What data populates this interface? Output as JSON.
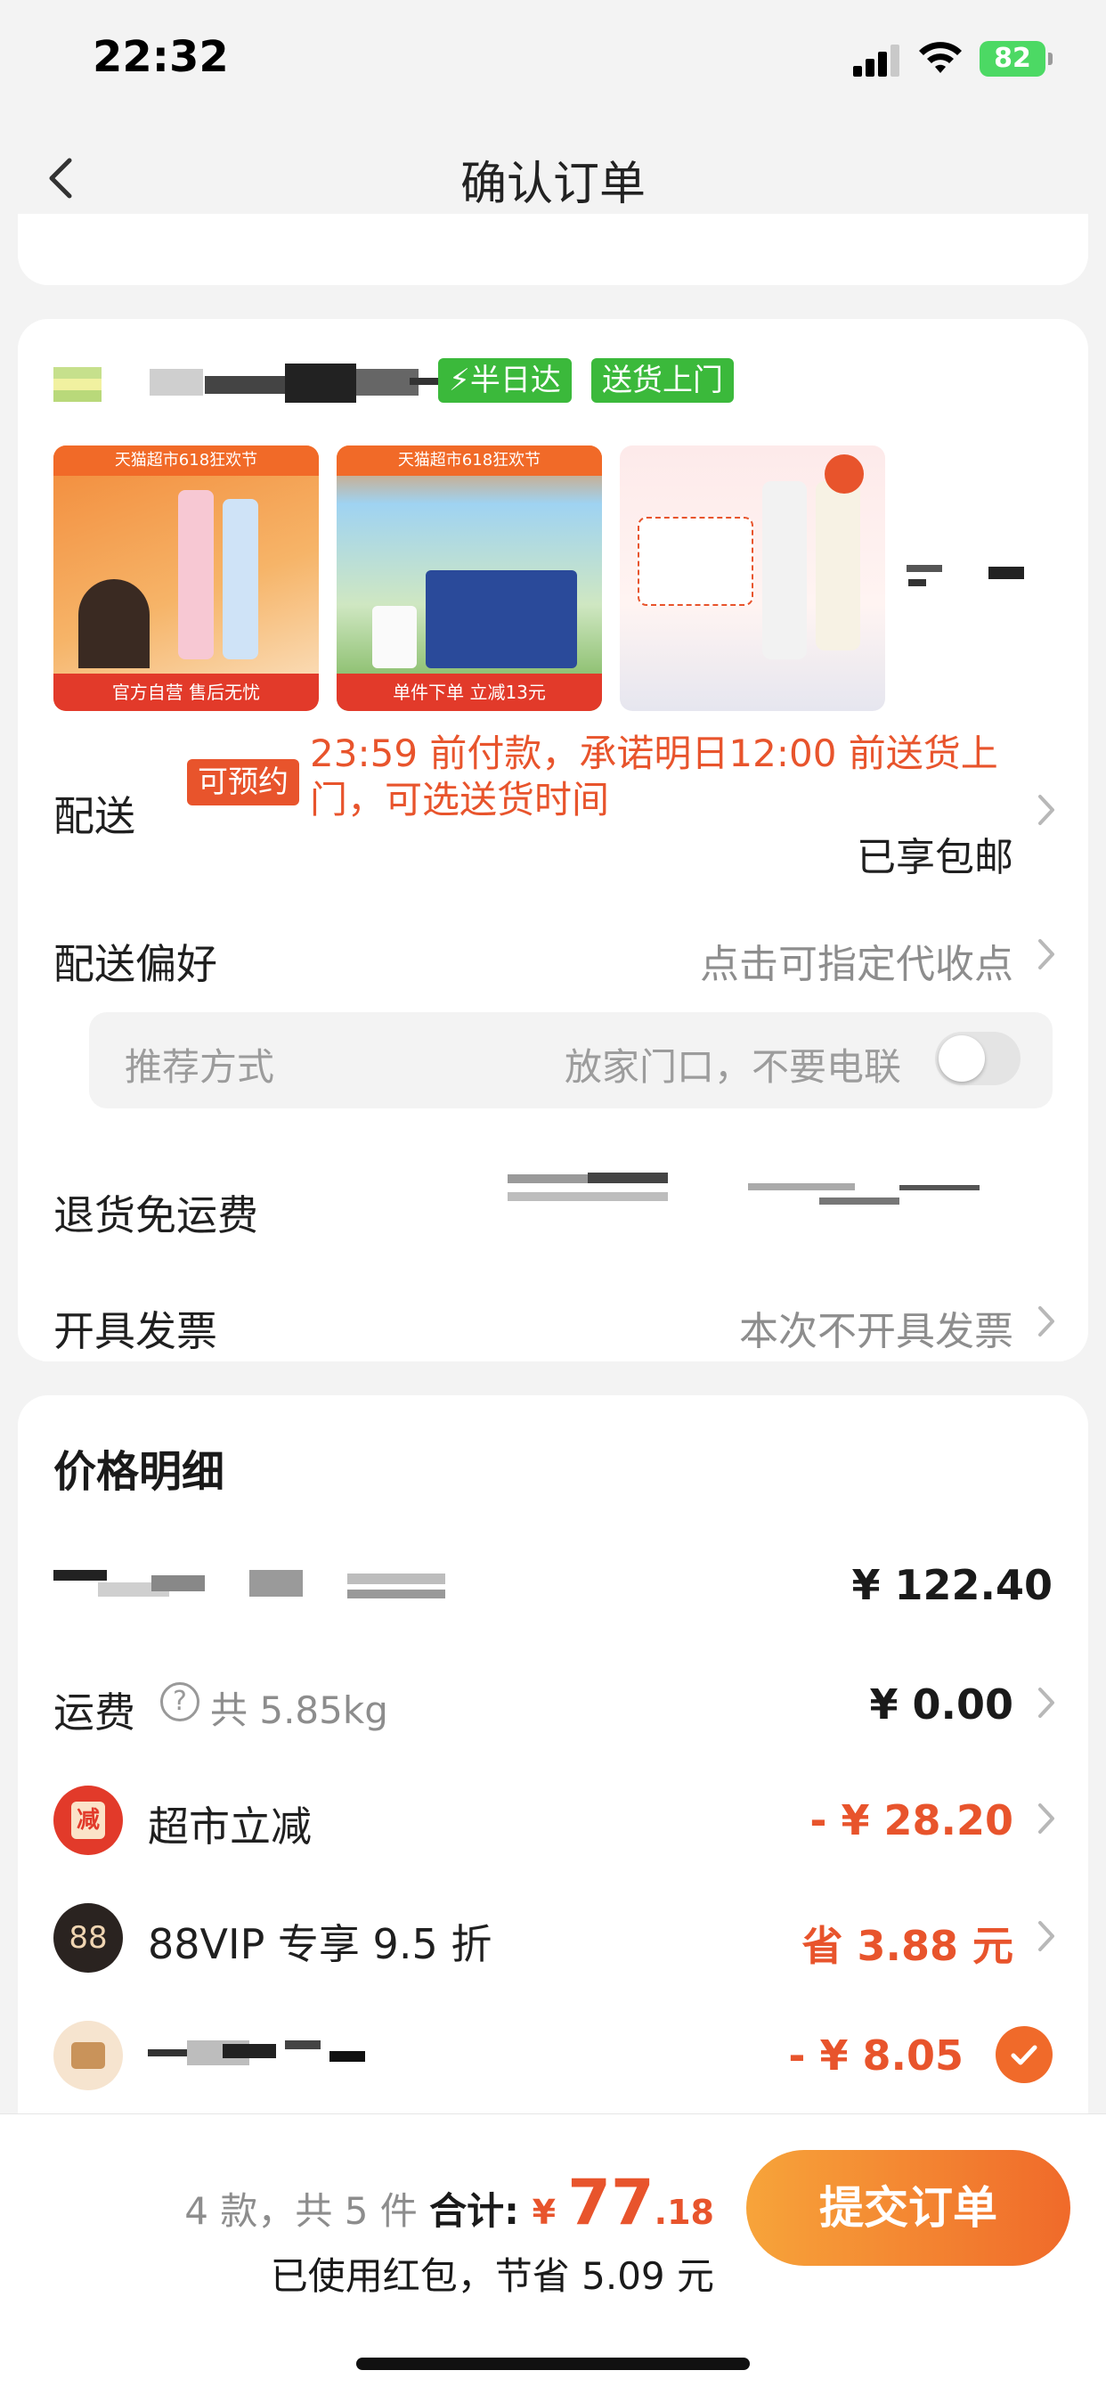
{
  "status_bar": {
    "time": "22:32",
    "battery": "82"
  },
  "nav": {
    "title": "确认订单"
  },
  "store": {
    "badges": [
      "⚡半日达",
      "送货上门"
    ],
    "thumbnails": [
      {
        "banner": "天猫超市618狂欢节",
        "strip": "官方自营 售后无忧"
      },
      {
        "banner": "天猫超市618狂欢节",
        "strip": "单件下单 立减13元"
      },
      {
        "banner": "",
        "strip": ""
      }
    ]
  },
  "delivery": {
    "label": "配送",
    "tag": "可预约",
    "text": "23:59 前付款，承诺明日12:00 前送货上门，可选送货时间",
    "free_shipping": "已享包邮"
  },
  "preference": {
    "label": "配送偏好",
    "value": "点击可指定代收点",
    "method_label": "推荐方式",
    "method_value": "放家门口，不要电联",
    "toggle_on": false
  },
  "return_shipping": {
    "label": "退货免运费"
  },
  "invoice": {
    "label": "开具发票",
    "value": "本次不开具发票"
  },
  "price_detail": {
    "title": "价格明细",
    "goods_amount": "¥ 122.40",
    "shipping": {
      "label": "运费",
      "weight": "共 5.85kg",
      "amount": "¥ 0.00"
    },
    "discount1": {
      "icon_text": "减",
      "label": "超市立减",
      "amount": "- ¥ 28.20"
    },
    "discount2": {
      "icon_text": "88",
      "label": "88VIP 专享 9.5 折",
      "amount": "省 3.88 元"
    },
    "discount3": {
      "amount": "- ¥ 8.05"
    }
  },
  "summary": {
    "count": "4 款，共 5 件 ",
    "total_label": "合计: ",
    "yen": "¥ ",
    "total_int": "77",
    "total_dec": ".18",
    "saved": "已使用红包，节省 5.09 元"
  },
  "submit": {
    "label": "提交订单"
  },
  "colors": {
    "accent": "#e8542c",
    "green_badge": "#3bb93b",
    "button_start": "#f7a43a",
    "button_end": "#f06a2a"
  }
}
